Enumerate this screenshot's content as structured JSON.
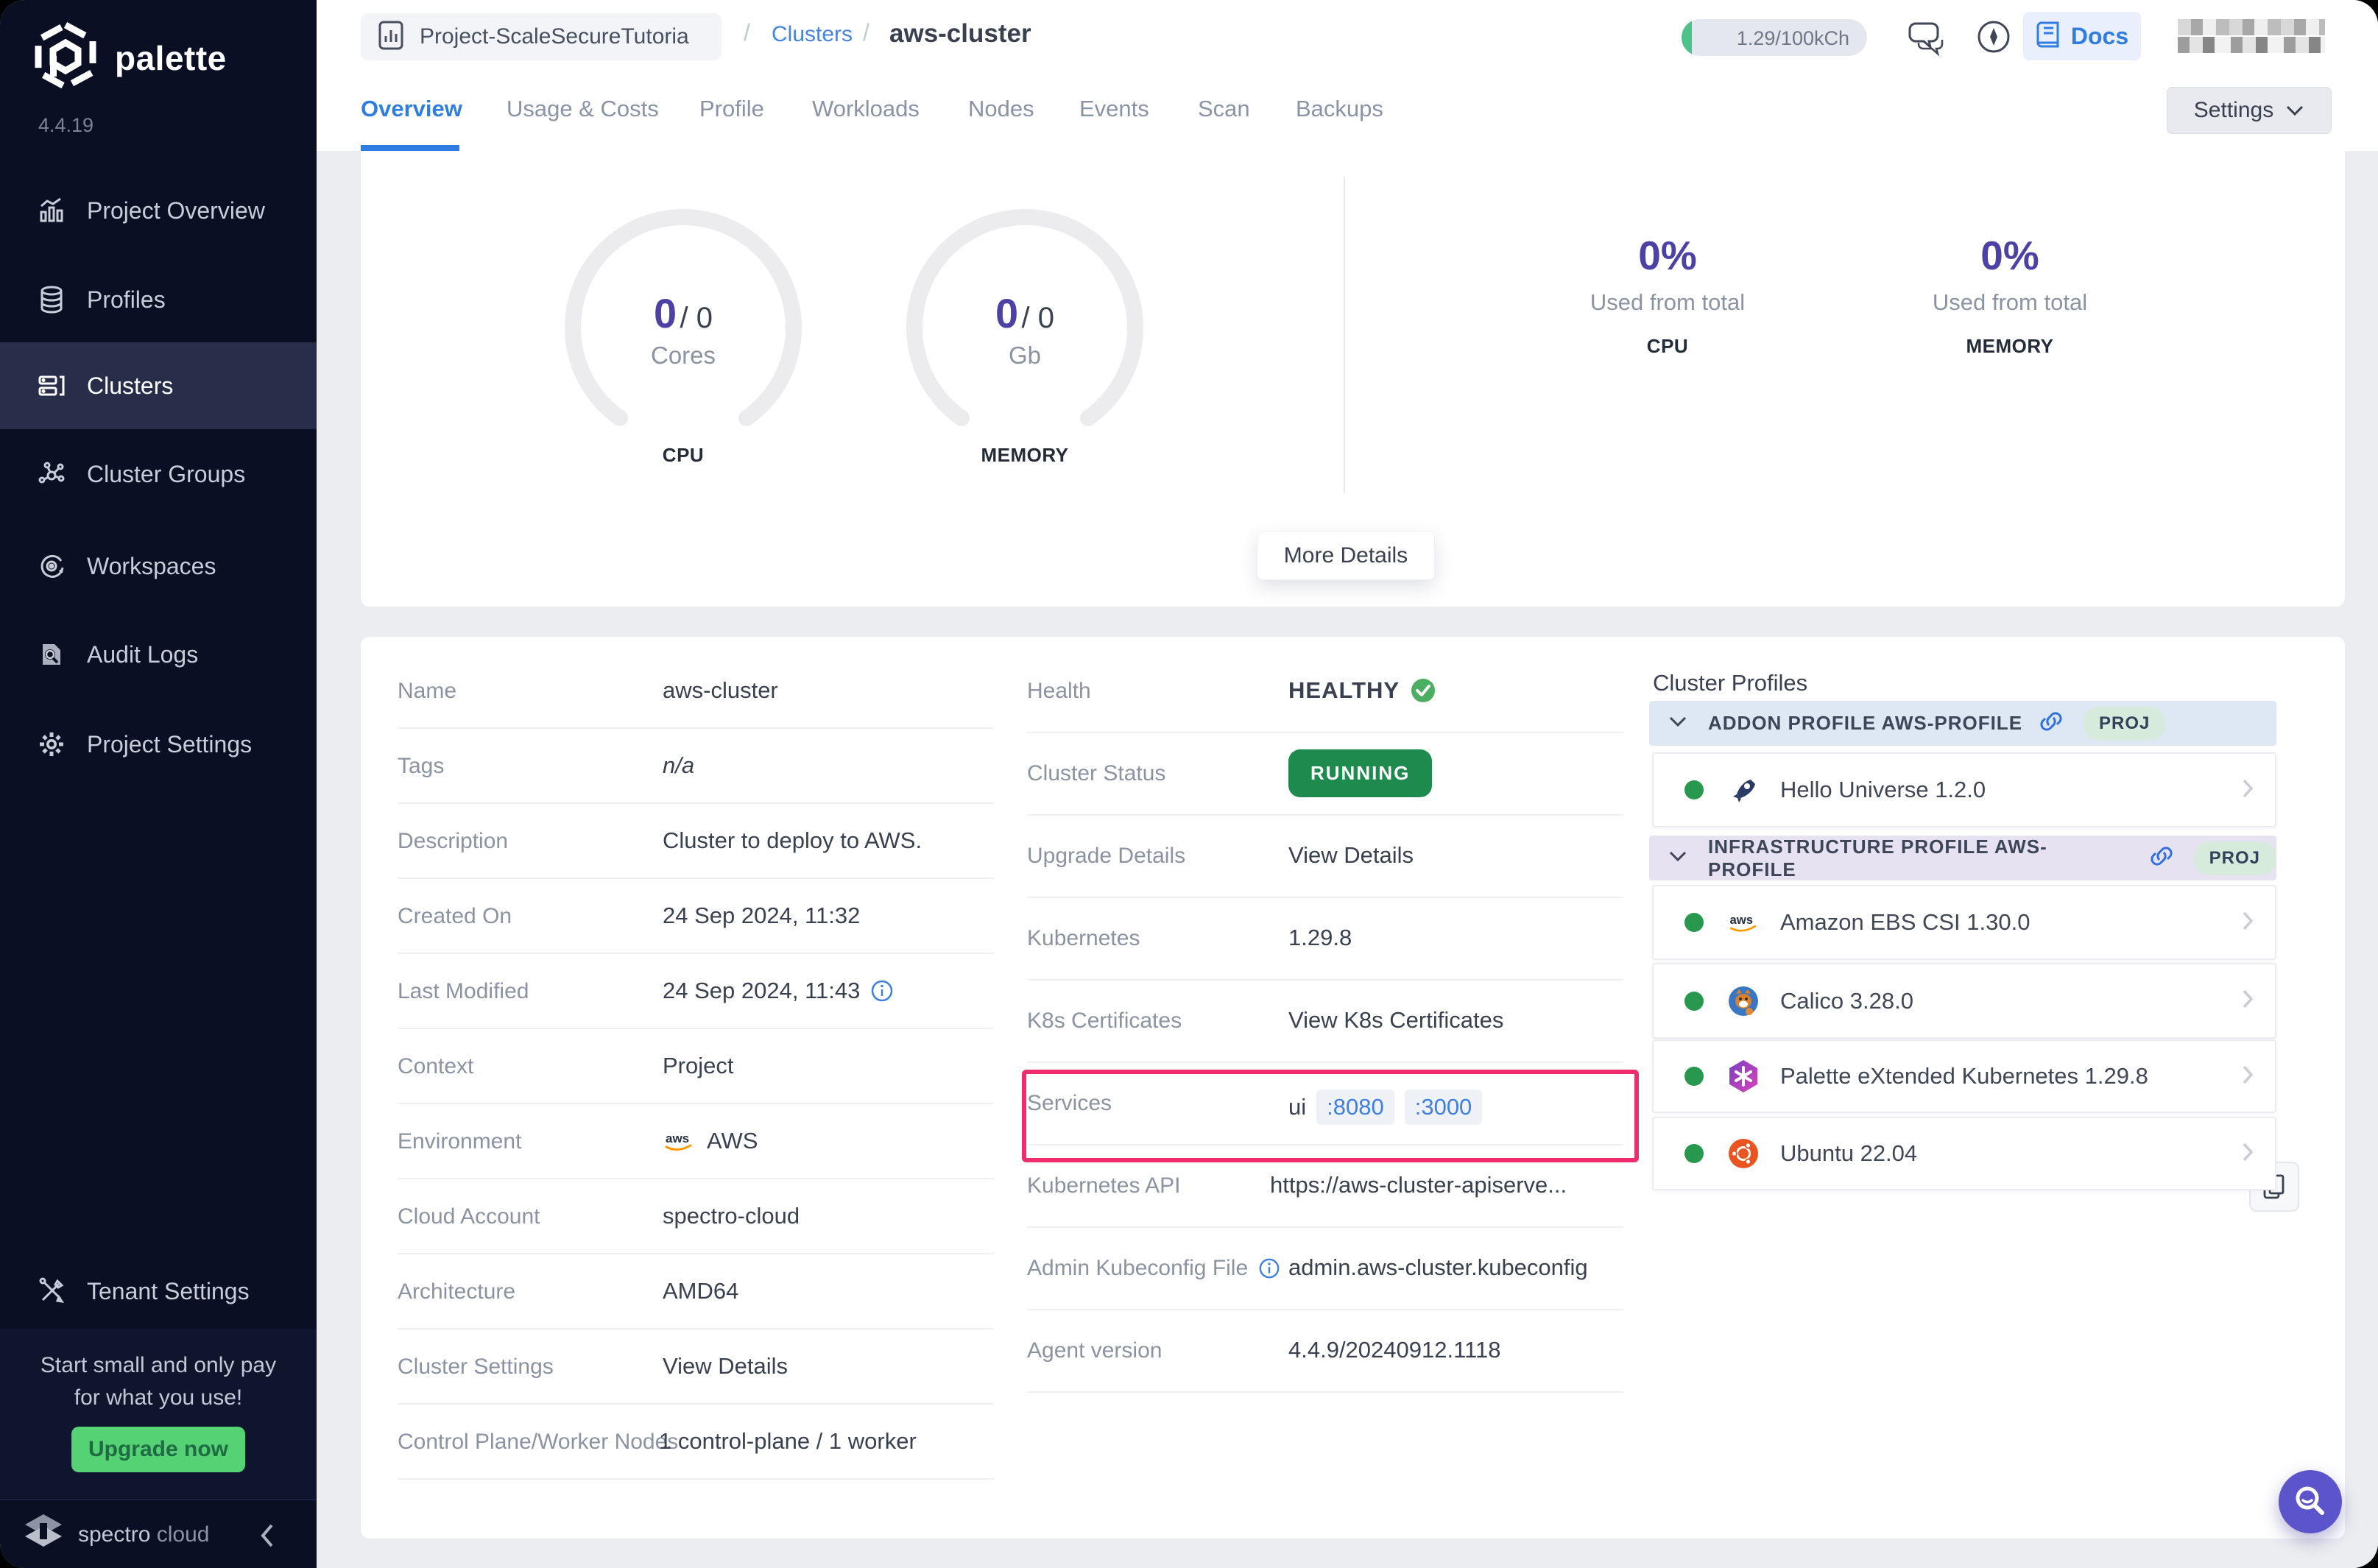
{
  "app": {
    "brand": "palette",
    "version": "4.4.19"
  },
  "colors": {
    "sidebar_bg": "#0a0f23",
    "accent_blue": "#2f7de1",
    "link_blue": "#3f7fe2",
    "purple": "#4c42a6",
    "green_dot": "#27984e",
    "running_bg": "#1d8a4e",
    "healthy_green": "#3fae5c",
    "highlight_pink": "#ee2e6c",
    "upgrade_green": "#55d273",
    "addon_header_bg": "#dde8f4",
    "infra_header_bg": "#e7e2f2",
    "proj_badge_bg": "#d7ebdd"
  },
  "sidebar": {
    "items": [
      {
        "label": "Project Overview"
      },
      {
        "label": "Profiles"
      },
      {
        "label": "Clusters"
      },
      {
        "label": "Cluster Groups"
      },
      {
        "label": "Workspaces"
      },
      {
        "label": "Audit Logs"
      },
      {
        "label": "Project Settings"
      }
    ],
    "tenant_item": {
      "label": "Tenant Settings"
    },
    "promo": {
      "line1": "Start small and only pay",
      "line2": "for what you use!",
      "button": "Upgrade now"
    },
    "footer": {
      "brand1": "spectro",
      "brand2": "cloud"
    }
  },
  "header": {
    "project_chip": "Project-ScaleSecureTutoria",
    "separator": "/",
    "clusters_link": "Clusters",
    "cluster_name": "aws-cluster",
    "usage_pill": "1.29/100kCh",
    "docs_label": "Docs"
  },
  "tabs": {
    "items": [
      "Overview",
      "Usage & Costs",
      "Profile",
      "Workloads",
      "Nodes",
      "Events",
      "Scan",
      "Backups"
    ],
    "active": "Overview",
    "settings_button": "Settings"
  },
  "usage_card": {
    "cpu_gauge": {
      "used": "0",
      "sep": "/",
      "total": "0",
      "unit": "Cores",
      "caption": "CPU"
    },
    "memory_gauge": {
      "used": "0",
      "sep": "/",
      "total": "0",
      "unit": "Gb",
      "caption": "MEMORY"
    },
    "cpu_stat": {
      "pct": "0%",
      "caption": "Used from total",
      "label": "CPU"
    },
    "memory_stat": {
      "pct": "0%",
      "caption": "Used from total",
      "label": "MEMORY"
    },
    "more_details": "More Details"
  },
  "details": {
    "rows": [
      {
        "label": "Name",
        "value": "aws-cluster"
      },
      {
        "label": "Tags",
        "value": "n/a"
      },
      {
        "label": "Description",
        "value": "Cluster to deploy to AWS."
      },
      {
        "label": "Created On",
        "value": "24 Sep 2024, 11:32"
      },
      {
        "label": "Last Modified",
        "value": "24 Sep 2024, 11:43"
      },
      {
        "label": "Context",
        "value": "Project"
      },
      {
        "label": "Environment",
        "value": "AWS"
      },
      {
        "label": "Cloud Account",
        "value": "spectro-cloud"
      },
      {
        "label": "Architecture",
        "value": "AMD64"
      },
      {
        "label": "Cluster Settings",
        "value": "View Details"
      },
      {
        "label": "Control Plane/Worker Nodes",
        "value": "1 control-plane / 1 worker"
      }
    ]
  },
  "status": {
    "health": {
      "label": "Health",
      "value": "HEALTHY"
    },
    "cluster_status": {
      "label": "Cluster Status",
      "value": "RUNNING"
    },
    "upgrade": {
      "label": "Upgrade Details",
      "value": "View Details"
    },
    "kubernetes": {
      "label": "Kubernetes",
      "value": "1.29.8"
    },
    "certs": {
      "label": "K8s Certificates",
      "value": "View K8s Certificates"
    },
    "services": {
      "label": "Services",
      "prefix": "ui",
      "ports": [
        ":8080",
        ":3000"
      ]
    },
    "api": {
      "label": "Kubernetes API",
      "value": "https://aws-cluster-apiserve..."
    },
    "kubeconfig": {
      "label": "Admin Kubeconfig File",
      "value": "admin.aws-cluster.kubeconfig"
    },
    "agent": {
      "label": "Agent version",
      "value": "4.4.9/20240912.1118"
    }
  },
  "profiles": {
    "title": "Cluster Profiles",
    "groups": [
      {
        "header": "ADDON PROFILE AWS-PROFILE",
        "badge": "PROJ",
        "items": [
          {
            "name": "Hello Universe 1.2.0"
          }
        ]
      },
      {
        "header": "INFRASTRUCTURE PROFILE AWS-PROFILE",
        "badge": "PROJ",
        "items": [
          {
            "name": "Amazon EBS CSI 1.30.0"
          },
          {
            "name": "Calico 3.28.0"
          },
          {
            "name": "Palette eXtended Kubernetes 1.29.8"
          },
          {
            "name": "Ubuntu 22.04"
          }
        ]
      }
    ]
  }
}
